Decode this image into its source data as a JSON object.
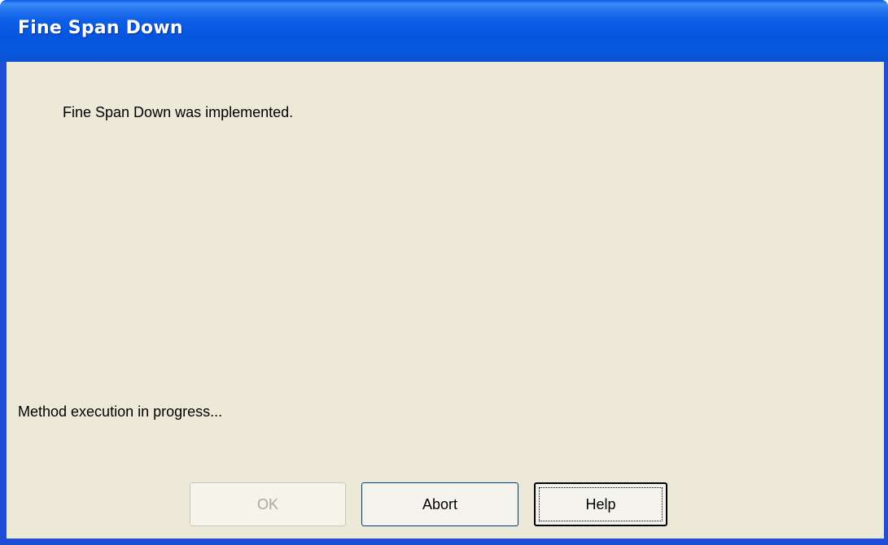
{
  "window": {
    "title": "Fine Span Down"
  },
  "dialog": {
    "message": "Fine Span Down was implemented.",
    "status": "Method execution in progress..."
  },
  "buttons": {
    "ok_label": "OK",
    "abort_label": "Abort",
    "help_label": "Help"
  },
  "colors": {
    "titlebar": "#0655de",
    "client_background": "#ece9d8",
    "disabled_text": "#aca899"
  }
}
